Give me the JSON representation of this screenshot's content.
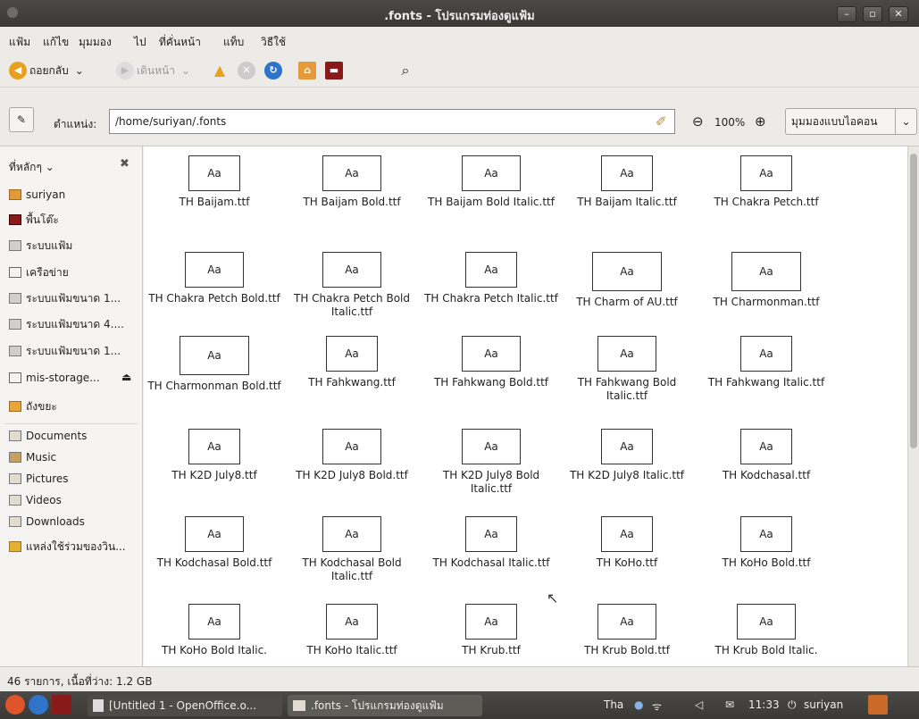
{
  "window": {
    "title": ".fonts - โปรแกรมท่องดูแฟ้ม"
  },
  "menu": [
    "แฟ้ม",
    "แก้ไข",
    "มุมมอง",
    "ไป",
    "ที่คั่นหน้า",
    "แท็บ",
    "วิธีใช้"
  ],
  "nav": {
    "back": "ถอยกลับ",
    "forward": "เดินหน้า"
  },
  "location": {
    "label": "ตำแหน่ง:",
    "path": "/home/suriyan/.fonts"
  },
  "zoom": "100%",
  "view_mode": "มุมมองแบบไอคอน",
  "sidebar": {
    "header": "ที่หลักๆ",
    "items": [
      {
        "label": "suriyan",
        "icon": "home"
      },
      {
        "label": "พื้นโต๊ะ",
        "icon": "desk"
      },
      {
        "label": "ระบบแฟ้ม",
        "icon": "fs"
      },
      {
        "label": "เครือข่าย",
        "icon": "net"
      },
      {
        "label": "ระบบแฟ้มขนาด 1...",
        "icon": "fs"
      },
      {
        "label": "ระบบแฟ้มขนาด 4....",
        "icon": "fs"
      },
      {
        "label": "ระบบแฟ้มขนาด 1...",
        "icon": "fs"
      },
      {
        "label": "mis-storage...",
        "icon": "net"
      },
      {
        "label": "ถังขยะ",
        "icon": "trash"
      }
    ],
    "bookmarks": [
      {
        "label": "Documents",
        "icon": "dir"
      },
      {
        "label": "Music",
        "icon": "music"
      },
      {
        "label": "Pictures",
        "icon": "dir"
      },
      {
        "label": "Videos",
        "icon": "dir"
      },
      {
        "label": "Downloads",
        "icon": "dir"
      },
      {
        "label": "แหล่งใช้ร่วมของวิน...",
        "icon": "share"
      }
    ]
  },
  "files": [
    {
      "name": "TH Baijam.ttf",
      "sample": "Aa",
      "family": "sans",
      "weight": "normal",
      "style": "normal"
    },
    {
      "name": "TH Baijam Bold.ttf",
      "sample": "Aa",
      "family": "sans",
      "weight": "bold",
      "style": "normal"
    },
    {
      "name": "TH Baijam Bold Italic.ttf",
      "sample": "Aa",
      "family": "sans",
      "weight": "bold",
      "style": "italic"
    },
    {
      "name": "TH Baijam Italic.ttf",
      "sample": "Aa",
      "family": "sans",
      "weight": "normal",
      "style": "italic"
    },
    {
      "name": "TH Chakra Petch.ttf",
      "sample": "Aa",
      "family": "sans",
      "weight": "normal",
      "style": "normal"
    },
    {
      "name": "TH Chakra Petch Bold.ttf",
      "sample": "Aa",
      "family": "sans",
      "weight": "bold",
      "style": "normal"
    },
    {
      "name": "TH Chakra Petch Bold Italic.ttf",
      "sample": "Aa",
      "family": "sans",
      "weight": "bold",
      "style": "italic"
    },
    {
      "name": "TH Chakra Petch Italic.ttf",
      "sample": "Aa",
      "family": "sans",
      "weight": "normal",
      "style": "italic"
    },
    {
      "name": "TH Charm of AU.ttf",
      "sample": "Aa",
      "family": "serif",
      "weight": "normal",
      "style": "italic"
    },
    {
      "name": "TH Charmonman.ttf",
      "sample": "Aa",
      "family": "serif",
      "weight": "normal",
      "style": "italic"
    },
    {
      "name": "TH Charmonman Bold.ttf",
      "sample": "Aa",
      "family": "serif",
      "weight": "bold",
      "style": "italic"
    },
    {
      "name": "TH Fahkwang.ttf",
      "sample": "Aa",
      "family": "sans",
      "weight": "normal",
      "style": "normal"
    },
    {
      "name": "TH Fahkwang Bold.ttf",
      "sample": "Aa",
      "family": "sans",
      "weight": "bold",
      "style": "normal"
    },
    {
      "name": "TH Fahkwang Bold Italic.ttf",
      "sample": "Aa",
      "family": "sans",
      "weight": "bold",
      "style": "italic"
    },
    {
      "name": "TH Fahkwang Italic.ttf",
      "sample": "Aa",
      "family": "sans",
      "weight": "normal",
      "style": "italic"
    },
    {
      "name": "TH K2D July8.ttf",
      "sample": "Aa",
      "family": "sans",
      "weight": "normal",
      "style": "normal"
    },
    {
      "name": "TH K2D July8 Bold.ttf",
      "sample": "Aa",
      "family": "sans",
      "weight": "bold",
      "style": "normal"
    },
    {
      "name": "TH K2D July8 Bold Italic.ttf",
      "sample": "Aa",
      "family": "sans",
      "weight": "bold",
      "style": "italic"
    },
    {
      "name": "TH K2D July8 Italic.ttf",
      "sample": "Aa",
      "family": "sans",
      "weight": "normal",
      "style": "italic"
    },
    {
      "name": "TH Kodchasal.ttf",
      "sample": "Aa",
      "family": "sans",
      "weight": "normal",
      "style": "normal"
    },
    {
      "name": "TH Kodchasal Bold.ttf",
      "sample": "Aa",
      "family": "sans",
      "weight": "bold",
      "style": "normal"
    },
    {
      "name": "TH Kodchasal Bold Italic.ttf",
      "sample": "Aa",
      "family": "sans",
      "weight": "bold",
      "style": "italic"
    },
    {
      "name": "TH Kodchasal Italic.ttf",
      "sample": "Aa",
      "family": "sans",
      "weight": "normal",
      "style": "italic"
    },
    {
      "name": "TH KoHo.ttf",
      "sample": "Aa",
      "family": "sans",
      "weight": "normal",
      "style": "normal"
    },
    {
      "name": "TH KoHo Bold.ttf",
      "sample": "Aa",
      "family": "sans",
      "weight": "normal",
      "style": "normal"
    },
    {
      "name": "TH KoHo Bold Italic.",
      "sample": "Aa",
      "family": "sans",
      "weight": "normal",
      "style": "italic"
    },
    {
      "name": "TH KoHo Italic.ttf",
      "sample": "Aa",
      "family": "sans",
      "weight": "normal",
      "style": "italic"
    },
    {
      "name": "TH Krub.ttf",
      "sample": "Aa",
      "family": "sans",
      "weight": "normal",
      "style": "normal"
    },
    {
      "name": "TH Krub Bold.ttf",
      "sample": "Aa",
      "family": "sans",
      "weight": "bold",
      "style": "normal"
    },
    {
      "name": "TH Krub Bold Italic.",
      "sample": "Aa",
      "family": "sans",
      "weight": "bold",
      "style": "italic"
    }
  ],
  "status": "46 รายการ, เนื้อที่ว่าง: 1.2 GB",
  "taskbar": {
    "tasks": [
      "[Untitled 1 - OpenOffice.o...",
      ".fonts - โปรแกรมท่องดูแฟ้ม"
    ],
    "keyboard": "Tha",
    "clock": "11:33",
    "user": "suriyan"
  }
}
